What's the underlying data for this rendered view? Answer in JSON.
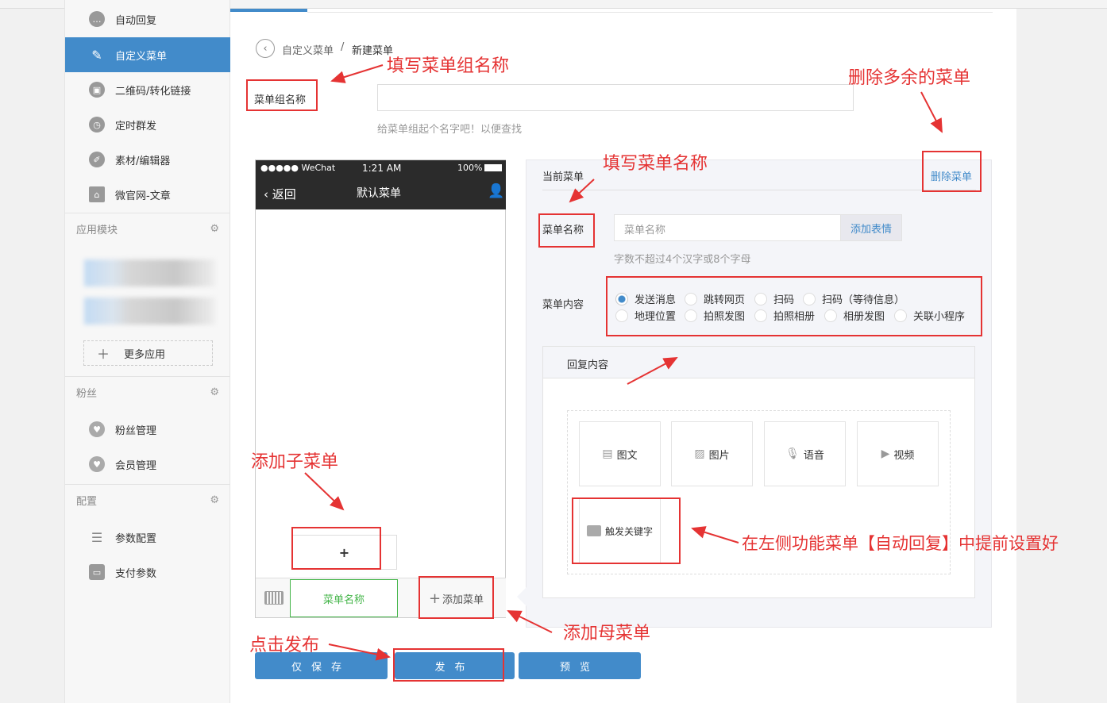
{
  "sidebar": {
    "items": [
      {
        "label": "自动回复",
        "icon": "chat-bubble-icon"
      },
      {
        "label": "自定义菜单",
        "icon": "edit-document-icon",
        "active": true
      },
      {
        "label": "二维码/转化链接",
        "icon": "qr-code-icon"
      },
      {
        "label": "定时群发",
        "icon": "clock-user-icon"
      },
      {
        "label": "素材/编辑器",
        "icon": "pencil-icon"
      },
      {
        "label": "微官网-文章",
        "icon": "home-icon"
      }
    ],
    "sections": {
      "apps": "应用模块",
      "fans": "粉丝",
      "config": "配置"
    },
    "more_apps": "更多应用",
    "fans_items": [
      {
        "label": "粉丝管理",
        "icon": "heart-icon"
      },
      {
        "label": "会员管理",
        "icon": "heart-icon"
      }
    ],
    "config_items": [
      {
        "label": "参数配置",
        "icon": "list-icon"
      },
      {
        "label": "支付参数",
        "icon": "wallet-icon"
      }
    ]
  },
  "breadcrumb": {
    "parent": "自定义菜单",
    "separator": "/",
    "current": "新建菜单"
  },
  "group": {
    "label": "菜单组名称",
    "value": "",
    "hint": "给菜单组起个名字吧！以便查找"
  },
  "phone": {
    "carrier": "●●●●● WeChat",
    "time": "1:21 AM",
    "battery": "100%",
    "back": "返回",
    "title": "默认菜单",
    "sub_add": "+",
    "menu_name": "菜单名称",
    "add_menu": "添加菜单"
  },
  "editor": {
    "current_label": "当前菜单",
    "delete_label": "删除菜单",
    "name_label": "菜单名称",
    "name_placeholder": "菜单名称",
    "emoji_btn": "添加表情",
    "name_hint": "字数不超过4个汉字或8个字母",
    "content_label": "菜单内容",
    "content_options": [
      "发送消息",
      "跳转网页",
      "扫码",
      "扫码（等待信息）",
      "地理位置",
      "拍照发图",
      "拍照相册",
      "相册发图",
      "关联小程序"
    ],
    "selected_option": "发送消息",
    "reply_label": "回复内容",
    "reply_types": [
      "图文",
      "图片",
      "语音",
      "视频"
    ],
    "keyword_tile": "触发关键字"
  },
  "buttons": {
    "save": "仅保存",
    "publish": "发布",
    "preview": "预览"
  },
  "annotations": {
    "fill_group": "填写菜单组名称",
    "delete_extra": "删除多余的菜单",
    "fill_name": "填写菜单名称",
    "add_sub": "添加子菜单",
    "add_parent": "添加母菜单",
    "click_publish": "点击发布",
    "keyword_note": "在左侧功能菜单【自动回复】中提前设置好"
  },
  "colors": {
    "accent": "#428bca",
    "green": "#44b549",
    "annotation": "#e53333"
  }
}
